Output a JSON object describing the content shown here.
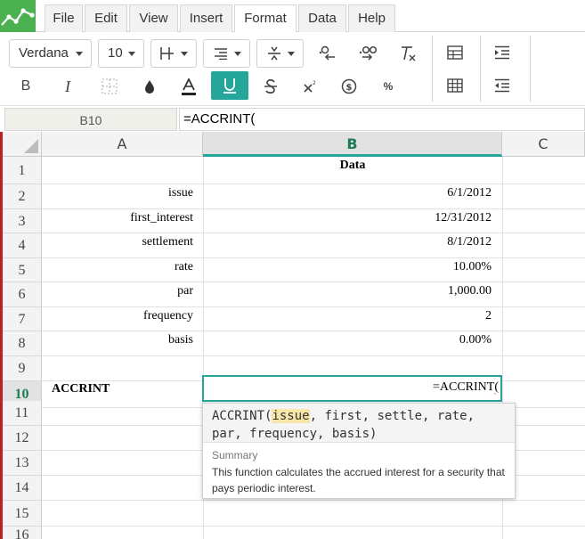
{
  "menu": {
    "items": [
      "File",
      "Edit",
      "View",
      "Insert",
      "Format",
      "Data",
      "Help"
    ],
    "active": "Format"
  },
  "toolbar": {
    "font_family": "Verdana",
    "font_size": "10",
    "underline_active": true,
    "accent_color": "#26a69a"
  },
  "formula_bar": {
    "cell_ref": "B10",
    "content": "=ACCRINT("
  },
  "grid": {
    "columns": [
      "A",
      "B",
      "C"
    ],
    "selected_column": "B",
    "rows": [
      "1",
      "2",
      "3",
      "4",
      "5",
      "6",
      "7",
      "8",
      "9",
      "10",
      "11",
      "12",
      "13",
      "14",
      "15",
      "16"
    ],
    "selected_row": "10",
    "cells": {
      "b1": "Data",
      "a2": "issue",
      "b2": "6/1/2012",
      "a3": "first_interest",
      "b3": "12/31/2012",
      "a4": "settlement",
      "b4": "8/1/2012",
      "a5": "rate",
      "b5": "10.00%",
      "a6": "par",
      "b6": "1,000.00",
      "a7": "frequency",
      "b7": "2",
      "a8": "basis",
      "b8": "0.00%",
      "a10": "ACCRINT",
      "b10_prefix": "=ACCRINT",
      "b10_paren": "("
    }
  },
  "tooltip": {
    "func": "ACCRINT(",
    "arg_active": "issue",
    "args_rest": ", first, settle, rate,",
    "line2": "par, frequency, basis)",
    "summary_label": "Summary",
    "description": "This function calculates the accrued interest for a security that pays periodic interest."
  }
}
